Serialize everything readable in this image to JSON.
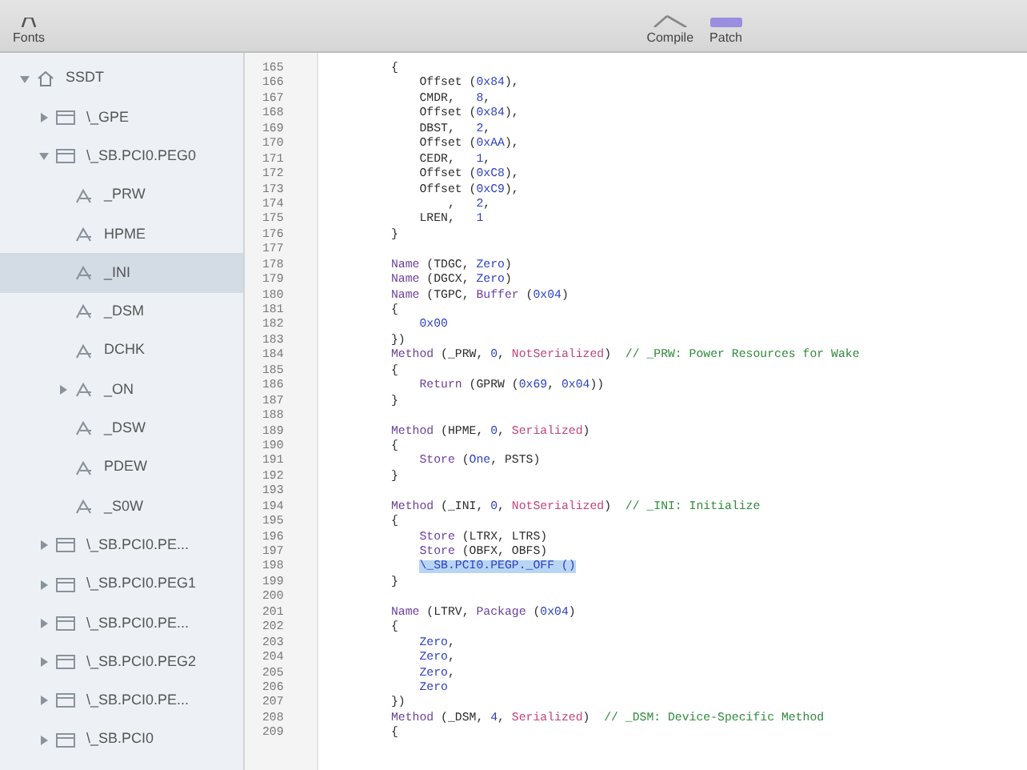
{
  "toolbar": {
    "items": [
      {
        "label": "Fonts",
        "kind": "fonts"
      },
      {
        "label": "Compile",
        "kind": "compile"
      },
      {
        "label": "Patch",
        "kind": "patch"
      }
    ]
  },
  "tree": [
    {
      "label": "SSDT",
      "kind": "root",
      "expanded": true,
      "selected": false,
      "children": [
        {
          "label": "\\_GPE",
          "kind": "scope",
          "expanded": false,
          "selected": false
        },
        {
          "label": "\\_SB.PCI0.PEG0",
          "kind": "scope",
          "expanded": true,
          "selected": false,
          "children": [
            {
              "label": "_PRW",
              "kind": "method",
              "selected": false
            },
            {
              "label": "HPME",
              "kind": "method",
              "selected": false
            },
            {
              "label": "_INI",
              "kind": "method",
              "selected": true
            },
            {
              "label": "_DSM",
              "kind": "method",
              "selected": false
            },
            {
              "label": "DCHK",
              "kind": "method",
              "selected": false
            },
            {
              "label": "_ON",
              "kind": "method",
              "expanded": false,
              "selected": false
            },
            {
              "label": "_DSW",
              "kind": "method",
              "selected": false
            },
            {
              "label": "PDEW",
              "kind": "method",
              "selected": false
            },
            {
              "label": "_S0W",
              "kind": "method",
              "selected": false
            }
          ]
        },
        {
          "label": "\\_SB.PCI0.PE...",
          "kind": "scope",
          "expanded": false,
          "selected": false
        },
        {
          "label": "\\_SB.PCI0.PEG1",
          "kind": "scope",
          "expanded": false,
          "selected": false
        },
        {
          "label": "\\_SB.PCI0.PE...",
          "kind": "scope",
          "expanded": false,
          "selected": false
        },
        {
          "label": "\\_SB.PCI0.PEG2",
          "kind": "scope",
          "expanded": false,
          "selected": false
        },
        {
          "label": "\\_SB.PCI0.PE...",
          "kind": "scope",
          "expanded": false,
          "selected": false
        },
        {
          "label": "\\_SB.PCI0",
          "kind": "scope",
          "expanded": false,
          "selected": false
        }
      ]
    }
  ],
  "editor": {
    "lines": [
      {
        "number": "165",
        "segments": [
          {
            "text": "        {",
            "kind": "plain"
          }
        ]
      },
      {
        "number": "166",
        "segments": [
          {
            "text": "            Offset (",
            "kind": "plain"
          },
          {
            "text": "0x84",
            "kind": "constant"
          },
          {
            "text": "),",
            "kind": "plain"
          }
        ]
      },
      {
        "number": "167",
        "segments": [
          {
            "text": "            CMDR,   ",
            "kind": "plain"
          },
          {
            "text": "8",
            "kind": "constant"
          },
          {
            "text": ",",
            "kind": "plain"
          }
        ]
      },
      {
        "number": "168",
        "segments": [
          {
            "text": "            Offset (",
            "kind": "plain"
          },
          {
            "text": "0x84",
            "kind": "constant"
          },
          {
            "text": "),",
            "kind": "plain"
          }
        ]
      },
      {
        "number": "169",
        "segments": [
          {
            "text": "            DBST,   ",
            "kind": "plain"
          },
          {
            "text": "2",
            "kind": "constant"
          },
          {
            "text": ",",
            "kind": "plain"
          }
        ]
      },
      {
        "number": "170",
        "segments": [
          {
            "text": "            Offset (",
            "kind": "plain"
          },
          {
            "text": "0xAA",
            "kind": "constant"
          },
          {
            "text": "),",
            "kind": "plain"
          }
        ]
      },
      {
        "number": "171",
        "segments": [
          {
            "text": "            CEDR,   ",
            "kind": "plain"
          },
          {
            "text": "1",
            "kind": "constant"
          },
          {
            "text": ",",
            "kind": "plain"
          }
        ]
      },
      {
        "number": "172",
        "segments": [
          {
            "text": "            Offset (",
            "kind": "plain"
          },
          {
            "text": "0xC8",
            "kind": "constant"
          },
          {
            "text": "),",
            "kind": "plain"
          }
        ]
      },
      {
        "number": "173",
        "segments": [
          {
            "text": "            Offset (",
            "kind": "plain"
          },
          {
            "text": "0xC9",
            "kind": "constant"
          },
          {
            "text": "),",
            "kind": "plain"
          }
        ]
      },
      {
        "number": "174",
        "segments": [
          {
            "text": "                ,   ",
            "kind": "plain"
          },
          {
            "text": "2",
            "kind": "constant"
          },
          {
            "text": ",",
            "kind": "plain"
          }
        ]
      },
      {
        "number": "175",
        "segments": [
          {
            "text": "            LREN,   ",
            "kind": "plain"
          },
          {
            "text": "1",
            "kind": "constant"
          }
        ]
      },
      {
        "number": "176",
        "segments": [
          {
            "text": "        }",
            "kind": "plain"
          }
        ]
      },
      {
        "number": "177"
      },
      {
        "number": "178",
        "segments": [
          {
            "text": "        Name",
            "kind": "keyword"
          },
          {
            "text": " (TDGC, ",
            "kind": "plain"
          },
          {
            "text": "Zero",
            "kind": "constant"
          },
          {
            "text": ")",
            "kind": "plain"
          }
        ]
      },
      {
        "number": "179",
        "segments": [
          {
            "text": "        Name",
            "kind": "keyword"
          },
          {
            "text": " (DGCX, ",
            "kind": "plain"
          },
          {
            "text": "Zero",
            "kind": "constant"
          },
          {
            "text": ")",
            "kind": "plain"
          }
        ]
      },
      {
        "number": "180",
        "segments": [
          {
            "text": "        Name",
            "kind": "keyword"
          },
          {
            "text": " (TGPC, ",
            "kind": "plain"
          },
          {
            "text": "Buffer",
            "kind": "keyword"
          },
          {
            "text": " (",
            "kind": "plain"
          },
          {
            "text": "0x04",
            "kind": "constant"
          },
          {
            "text": ")",
            "kind": "plain"
          }
        ]
      },
      {
        "number": "181",
        "segments": [
          {
            "text": "        {",
            "kind": "plain"
          }
        ]
      },
      {
        "number": "182",
        "segments": [
          {
            "text": "            0x00",
            "kind": "constant"
          }
        ]
      },
      {
        "number": "183",
        "segments": [
          {
            "text": "        })",
            "kind": "plain"
          }
        ]
      },
      {
        "number": "184",
        "segments": [
          {
            "text": "        Method",
            "kind": "keyword"
          },
          {
            "text": " (_PRW, ",
            "kind": "plain"
          },
          {
            "text": "0",
            "kind": "constant"
          },
          {
            "text": ", ",
            "kind": "plain"
          },
          {
            "text": "NotSerialized",
            "kind": "attribute"
          },
          {
            "text": ")  ",
            "kind": "plain"
          },
          {
            "text": "// _PRW: Power Resources for Wake",
            "kind": "comment"
          }
        ]
      },
      {
        "number": "185",
        "segments": [
          {
            "text": "        {",
            "kind": "plain"
          }
        ]
      },
      {
        "number": "186",
        "segments": [
          {
            "text": "            Return",
            "kind": "keyword"
          },
          {
            "text": " (GPRW (",
            "kind": "plain"
          },
          {
            "text": "0x69",
            "kind": "constant"
          },
          {
            "text": ", ",
            "kind": "plain"
          },
          {
            "text": "0x04",
            "kind": "constant"
          },
          {
            "text": "))",
            "kind": "plain"
          }
        ]
      },
      {
        "number": "187",
        "segments": [
          {
            "text": "        }",
            "kind": "plain"
          }
        ]
      },
      {
        "number": "188"
      },
      {
        "number": "189",
        "segments": [
          {
            "text": "        Method",
            "kind": "keyword"
          },
          {
            "text": " (HPME, ",
            "kind": "plain"
          },
          {
            "text": "0",
            "kind": "constant"
          },
          {
            "text": ", ",
            "kind": "plain"
          },
          {
            "text": "Serialized",
            "kind": "attribute"
          },
          {
            "text": ")",
            "kind": "plain"
          }
        ]
      },
      {
        "number": "190",
        "segments": [
          {
            "text": "        {",
            "kind": "plain"
          }
        ]
      },
      {
        "number": "191",
        "segments": [
          {
            "text": "            Store",
            "kind": "keyword"
          },
          {
            "text": " (",
            "kind": "plain"
          },
          {
            "text": "One",
            "kind": "constant"
          },
          {
            "text": ", PSTS)",
            "kind": "plain"
          }
        ]
      },
      {
        "number": "192",
        "segments": [
          {
            "text": "        }",
            "kind": "plain"
          }
        ]
      },
      {
        "number": "193"
      },
      {
        "number": "194",
        "segments": [
          {
            "text": "        Method",
            "kind": "keyword"
          },
          {
            "text": " (_INI, ",
            "kind": "plain"
          },
          {
            "text": "0",
            "kind": "constant"
          },
          {
            "text": ", ",
            "kind": "plain"
          },
          {
            "text": "NotSerialized",
            "kind": "attribute"
          },
          {
            "text": ")  ",
            "kind": "plain"
          },
          {
            "text": "// _INI: Initialize",
            "kind": "comment"
          }
        ]
      },
      {
        "number": "195",
        "segments": [
          {
            "text": "        {",
            "kind": "plain"
          }
        ]
      },
      {
        "number": "196",
        "segments": [
          {
            "text": "            Store",
            "kind": "keyword"
          },
          {
            "text": " (LTRX, LTRS)",
            "kind": "plain"
          }
        ]
      },
      {
        "number": "197",
        "segments": [
          {
            "text": "            Store",
            "kind": "keyword"
          },
          {
            "text": " (OBFX, OBFS)",
            "kind": "plain"
          }
        ]
      },
      {
        "number": "198",
        "segments": [
          {
            "text": "            \\_SB.PCI0.PEGP._OFF ()",
            "kind": "selection"
          }
        ]
      },
      {
        "number": "199",
        "segments": [
          {
            "text": "        }",
            "kind": "plain"
          }
        ]
      },
      {
        "number": "200"
      },
      {
        "number": "201",
        "segments": [
          {
            "text": "        Name",
            "kind": "keyword"
          },
          {
            "text": " (LTRV, ",
            "kind": "plain"
          },
          {
            "text": "Package",
            "kind": "keyword"
          },
          {
            "text": " (",
            "kind": "plain"
          },
          {
            "text": "0x04",
            "kind": "constant"
          },
          {
            "text": ")",
            "kind": "plain"
          }
        ]
      },
      {
        "number": "202",
        "segments": [
          {
            "text": "        {",
            "kind": "plain"
          }
        ]
      },
      {
        "number": "203",
        "segments": [
          {
            "text": "            Zero",
            "kind": "constant"
          },
          {
            "text": ",",
            "kind": "plain"
          }
        ]
      },
      {
        "number": "204",
        "segments": [
          {
            "text": "            Zero",
            "kind": "constant"
          },
          {
            "text": ",",
            "kind": "plain"
          }
        ]
      },
      {
        "number": "205",
        "segments": [
          {
            "text": "            Zero",
            "kind": "constant"
          },
          {
            "text": ",",
            "kind": "plain"
          }
        ]
      },
      {
        "number": "206",
        "segments": [
          {
            "text": "            Zero",
            "kind": "constant"
          }
        ]
      },
      {
        "number": "207",
        "segments": [
          {
            "text": "        })",
            "kind": "plain"
          }
        ]
      },
      {
        "number": "208",
        "segments": [
          {
            "text": "        Method",
            "kind": "keyword"
          },
          {
            "text": " (_DSM, ",
            "kind": "plain"
          },
          {
            "text": "4",
            "kind": "constant"
          },
          {
            "text": ", ",
            "kind": "plain"
          },
          {
            "text": "Serialized",
            "kind": "attribute"
          },
          {
            "text": ")  ",
            "kind": "plain"
          },
          {
            "text": "// _DSM: Device-Specific Method",
            "kind": "comment"
          }
        ]
      },
      {
        "number": "209",
        "segments": [
          {
            "text": "        {",
            "kind": "plain"
          }
        ]
      }
    ]
  }
}
